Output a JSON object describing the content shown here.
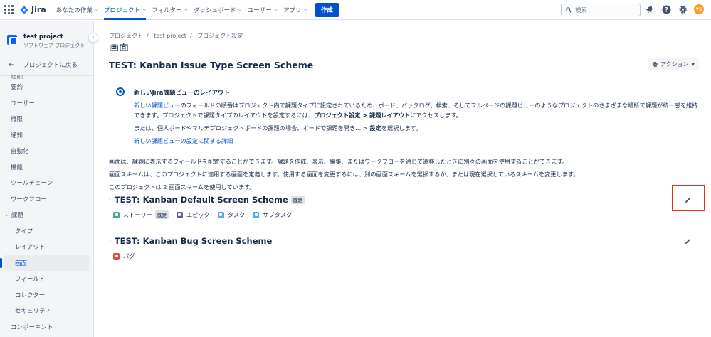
{
  "topnav": {
    "logo_text": "Jira",
    "items": [
      {
        "label": "あなたの作業",
        "active": false
      },
      {
        "label": "プロジェクト",
        "active": true
      },
      {
        "label": "フィルター",
        "active": false
      },
      {
        "label": "ダッシュボード",
        "active": false
      },
      {
        "label": "ユーザー",
        "active": false
      },
      {
        "label": "アプリ",
        "active": false
      }
    ],
    "create_label": "作成",
    "search_placeholder": "検索",
    "avatar_initials": "YS"
  },
  "sidebar": {
    "project_name": "test project",
    "project_type": "ソフトウェア プロジェクト",
    "back_label": "プロジェクトに戻る",
    "partial_item": "詳細",
    "items": [
      {
        "label": "要約"
      },
      {
        "label": "ユーザー"
      },
      {
        "label": "権限"
      },
      {
        "label": "通知"
      },
      {
        "label": "自動化"
      },
      {
        "label": "機能"
      },
      {
        "label": "ツールチェーン"
      },
      {
        "label": "ワークフロー"
      }
    ],
    "group_label": "課題",
    "sub_items": [
      {
        "label": "タイプ"
      },
      {
        "label": "レイアウト"
      },
      {
        "label": "画面",
        "selected": true
      },
      {
        "label": "フィールド"
      },
      {
        "label": "コレクター"
      },
      {
        "label": "セキュリティ"
      }
    ],
    "last_item": "コンポーネント"
  },
  "main": {
    "breadcrumb": [
      "プロジェクト",
      "test project",
      "プロジェクト設定"
    ],
    "page_title": "画面",
    "scheme_title": "TEST: Kanban Issue Type Screen Scheme",
    "action_label": "アクション",
    "info": {
      "title": "新しいJira課題ビューのレイアウト",
      "p1_link": "新しい課題ビュー",
      "p1_text": "のフィールドの順番はプロジェクト内で課題タイプに設定されているため、ボード、バックログ、検索、そしてフルページの課題ビューのようなプロジェクトのさまざまな場所で課題が統一感を維持",
      "p1_line2_pre": "できます。プロジェクトで課題タイプのレイアウトを設定するには、",
      "p1_line2_bold": "プロジェクト設定 > 課題レイアウト",
      "p1_line2_post": "にアクセスします。",
      "p2_pre": "または、個人ボードやマルチプロジェクトボードの課題の場合、ボードで課題を開き… > ",
      "p2_bold": "設定",
      "p2_post": "を選択します。",
      "link": "新しい課題ビューの設定に関する詳細"
    },
    "para1": "画面は、課題に表示するフィールドを配置することができます。課題を作成、表示、編集、またはワークフローを通じて遷移したときに別々の画面を使用することができます。",
    "para2": "画面スキームは、このプロジェクトに適用する画面を定義します。使用する画面を変更するには、別の画面スキームを選択するか、または現在選択しているスキームを変更します。",
    "para3": "このプロジェクトは 2 画面スキームを使用しています。",
    "schemes": [
      {
        "name": "TEST: Kanban Default Screen Scheme",
        "badge": "既定",
        "issue_types": [
          {
            "label": "ストーリー",
            "color": "#36b37e",
            "badge": "既定"
          },
          {
            "label": "エピック",
            "color": "#6554c0"
          },
          {
            "label": "タスク",
            "color": "#4bade8"
          },
          {
            "label": "サブタスク",
            "color": "#4bade8"
          }
        ]
      },
      {
        "name": "TEST: Kanban Bug Screen Scheme",
        "issue_types": [
          {
            "label": "バグ",
            "color": "#e5493a"
          }
        ]
      }
    ]
  }
}
